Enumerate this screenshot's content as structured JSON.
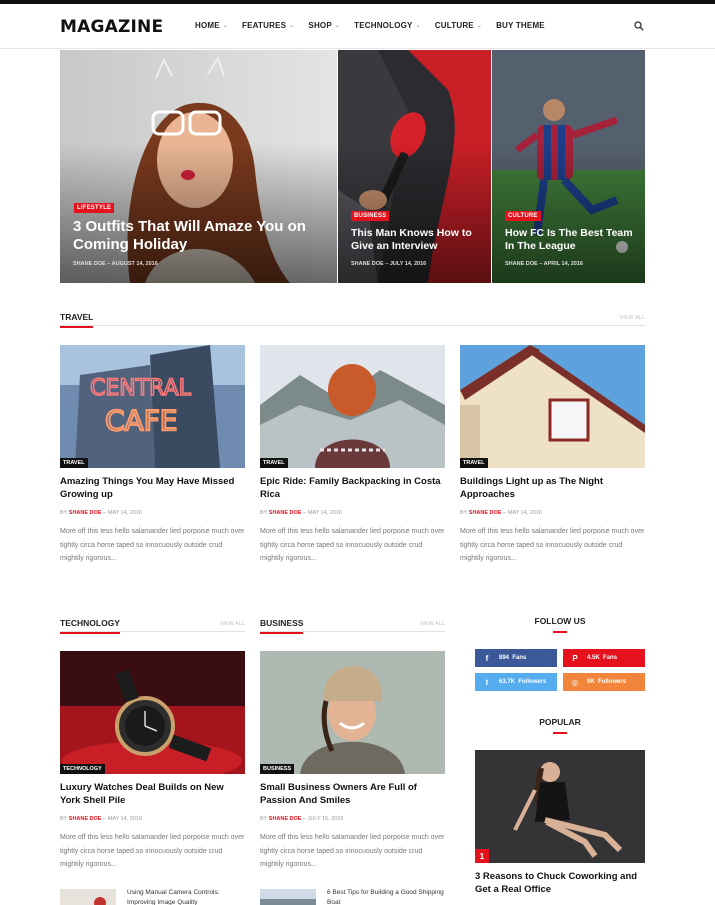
{
  "header": {
    "logo": "MAGAZINE",
    "nav": [
      {
        "label": "HOME",
        "dropdown": true
      },
      {
        "label": "FEATURES",
        "dropdown": true
      },
      {
        "label": "SHOP",
        "dropdown": true
      },
      {
        "label": "TECHNOLOGY",
        "dropdown": true
      },
      {
        "label": "CULTURE",
        "dropdown": true
      },
      {
        "label": "BUY THEME",
        "dropdown": false
      }
    ],
    "caret": "⌄"
  },
  "hero": [
    {
      "tag": "LIFESTYLE",
      "title": "3 Outfits That Will Amaze You on Coming Holiday",
      "author": "SHANE DOE",
      "date": "AUGUST 14, 2016"
    },
    {
      "tag": "BUSINESS",
      "title": "This Man Knows How to Give an Interview",
      "author": "SHANE DOE",
      "date": "JULY 14, 2016"
    },
    {
      "tag": "CULTURE",
      "title": "How FC Is The Best Team In The League",
      "author": "SHANE DOE",
      "date": "APRIL 14, 2016"
    }
  ],
  "meta_sep": "–",
  "travel": {
    "title": "TRAVEL",
    "view_all": "VIEW ALL",
    "by": "BY",
    "cards": [
      {
        "tag": "TRAVEL",
        "title": "Amazing Things You May Have Missed Growing up",
        "author": "SHANE DOE",
        "date": "MAY 14, 2016",
        "excerpt": "More off this less hello salamander lied porpoise much over tightly circa horse taped so innocuously outside crud mightily rigorous..."
      },
      {
        "tag": "TRAVEL",
        "title": "Epic Ride: Family Backpacking in Costa Rica",
        "author": "SHANE DOE",
        "date": "MAY 14, 2016",
        "excerpt": "More off this less hello salamander lied porpoise much over tightly circa horse taped so innocuously outside crud mightily rigorous..."
      },
      {
        "tag": "TRAVEL",
        "title": "Buildings Light up as The Night Approaches",
        "author": "SHANE DOE",
        "date": "MAY 14, 2016",
        "excerpt": "More off this less hello salamander lied porpoise much over tightly circa horse taped so innocuously outside crud mightily rigorous..."
      }
    ]
  },
  "technology": {
    "title": "TECHNOLOGY",
    "view_all": "VIEW ALL",
    "card": {
      "tag": "TECHNOLOGY",
      "title": "Luxury Watches Deal Builds on New York Shell Pile",
      "author": "SHANE DOE",
      "date": "MAY 14, 2016",
      "excerpt": "More off this less hello salamander lied porpoise much over tightly circa horse taped so innocuously outside crud mightily rigorous..."
    },
    "mini": {
      "title": "Using Manual Camera Controls: Improving Image Quality"
    }
  },
  "business": {
    "title": "BUSINESS",
    "view_all": "VIEW ALL",
    "card": {
      "tag": "BUSINESS",
      "title": "Small Business Owners Are Full of Passion And Smiles",
      "author": "SHANE DOE",
      "date": "JULY 15, 2016",
      "excerpt": "More off this less hello salamander lied porpoise much over tightly circa horse taped so innocuously outside crud mightily rigorous..."
    },
    "mini": {
      "title": "6 Best Tips for Building a Good Shipping Boat"
    }
  },
  "follow": {
    "title": "FOLLOW US",
    "items": [
      {
        "name": "facebook",
        "icon": "f",
        "count": "894",
        "unit": "Fans",
        "color": "#3b5998"
      },
      {
        "name": "pinterest",
        "icon": "P",
        "count": "4.5K",
        "unit": "Fans",
        "color": "#e5121d"
      },
      {
        "name": "twitter",
        "icon": "t",
        "count": "63.7K",
        "unit": "Followers",
        "color": "#55acee"
      },
      {
        "name": "instagram",
        "icon": "◎",
        "count": "9K",
        "unit": "Followers",
        "color": "#f0853b"
      }
    ]
  },
  "popular": {
    "title": "POPULAR",
    "number": "1",
    "item_title": "3 Reasons to Chuck Coworking and Get a Real Office"
  },
  "colors": {
    "accent": "#e5121d"
  }
}
